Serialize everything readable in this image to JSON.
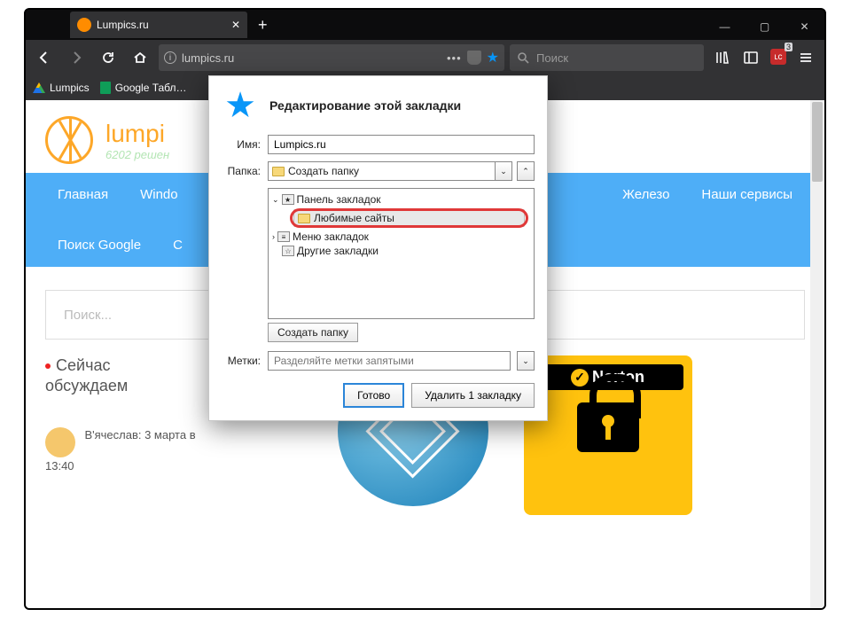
{
  "tab": {
    "title": "Lumpics.ru"
  },
  "url": "lumpics.ru",
  "search_placeholder": "Поиск",
  "bookmarks_bar": {
    "items": [
      {
        "label": "Lumpics"
      },
      {
        "label": "Google Табл…"
      }
    ]
  },
  "ext_badge": {
    "label": "ʟc",
    "count": "3"
  },
  "popup": {
    "title": "Редактирование этой закладки",
    "name_label": "Имя:",
    "name_value": "Lumpics.ru",
    "folder_label": "Папка:",
    "folder_value": "Создать папку",
    "tree": {
      "toolbar": "Панель закладок",
      "favorite": "Любимые сайты",
      "menu": "Меню закладок",
      "other": "Другие закладки"
    },
    "new_folder_btn": "Создать папку",
    "tags_label": "Метки:",
    "tags_placeholder": "Разделяйте метки запятыми",
    "done_btn": "Готово",
    "remove_btn": "Удалить 1 закладку"
  },
  "page": {
    "sitename": "lumpi",
    "tagline": "6202 решен",
    "menu": {
      "home": "Главная",
      "windows": "Windo",
      "hardware": "Железо",
      "services": "Наши сервисы",
      "google": "Поиск Google",
      "c": "С"
    },
    "search_placeholder": "Поиск...",
    "discuss_title1": "Сейчас",
    "discuss_title2": "обсуждаем",
    "comment": "В'ячеслав: 3 марта в 13:40",
    "norton": "Norton"
  }
}
